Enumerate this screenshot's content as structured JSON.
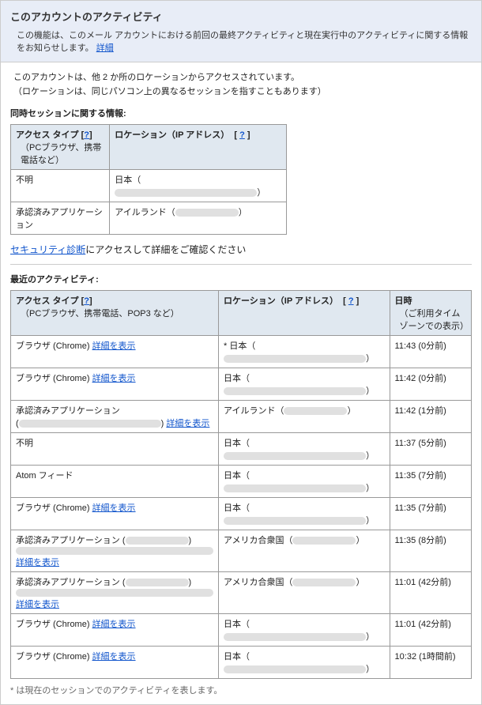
{
  "header": {
    "title": "このアカウントのアクティビティ",
    "description": "この機能は、このメール アカウントにおける前回の最終アクティビティと現在実行中のアクティビティに関する情報をお知らせします。",
    "details_link": "詳細"
  },
  "access_info": {
    "line1": "このアカウントは、他 2 か所のロケーションからアクセスされています。",
    "line2": "（ロケーションは、同じパソコン上の異なるセッションを指すこともあります）"
  },
  "concurrent": {
    "title": "同時セッションに関する情報:",
    "col1": "アクセス タイプ",
    "col1_help": "?",
    "col1_sub": "（PCブラウザ、携帯電話など）",
    "col2": "ロケーション（IP アドレス）",
    "col2_help": "?",
    "rows": [
      {
        "type": "不明",
        "loc_prefix": "日本（",
        "loc_suffix": "）"
      },
      {
        "type": "承認済みアプリケーション",
        "loc_prefix": "アイルランド（",
        "loc_suffix": "）"
      }
    ]
  },
  "security": {
    "link": "セキュリティ診断",
    "text": "にアクセスして詳細をご確認ください"
  },
  "recent": {
    "title": "最近のアクティビティ:",
    "col1": "アクセス タイプ",
    "col1_help": "?",
    "col1_sub": "（PCブラウザ、携帯電話、POP3 など）",
    "col2": "ロケーション（IP アドレス）",
    "col2_help": "?",
    "col3": "日時",
    "col3_sub": "（ご利用タイム ゾーンでの表示）",
    "detail_link": "詳細を表示",
    "rows": [
      {
        "type": "ブラウザ (Chrome) ",
        "loc_prefix": "* 日本（",
        "loc_suffix": "）",
        "time": "11:43 (0分前)"
      },
      {
        "type": "ブラウザ (Chrome) ",
        "loc_prefix": "日本（",
        "loc_suffix": "）",
        "time": "11:42 (0分前)"
      },
      {
        "type_pre": "承認済みアプリケーション",
        "type_paren": true,
        "loc_prefix": "アイルランド（",
        "loc_suffix": "）",
        "time": "11:42 (1分前)"
      },
      {
        "type": "不明",
        "no_link": true,
        "loc_prefix": "日本（",
        "loc_suffix": "）",
        "time": "11:37 (5分前)"
      },
      {
        "type": "Atom フィード",
        "no_link": true,
        "loc_prefix": "日本（",
        "loc_suffix": "）",
        "time": "11:35 (7分前)"
      },
      {
        "type": "ブラウザ (Chrome) ",
        "loc_prefix": "日本（",
        "loc_suffix": "）",
        "time": "11:35 (7分前)"
      },
      {
        "type_pre": "承認済みアプリケーション (",
        "type_suf": ")",
        "multiline": true,
        "loc_prefix": "アメリカ合衆国（",
        "loc_suffix": "）",
        "time": "11:35 (8分前)"
      },
      {
        "type_pre": "承認済みアプリケーション (",
        "type_suf": ")",
        "multiline": true,
        "loc_prefix": "アメリカ合衆国（",
        "loc_suffix": "）",
        "time": "11:01 (42分前)"
      },
      {
        "type": "ブラウザ (Chrome) ",
        "loc_prefix": "日本（",
        "loc_suffix": "）",
        "time": "11:01 (42分前)"
      },
      {
        "type": "ブラウザ (Chrome) ",
        "loc_prefix": "日本（",
        "loc_suffix": "）",
        "time": "10:32 (1時間前)"
      }
    ]
  },
  "footnote": "* は現在のセッションでのアクティビティを表します。"
}
